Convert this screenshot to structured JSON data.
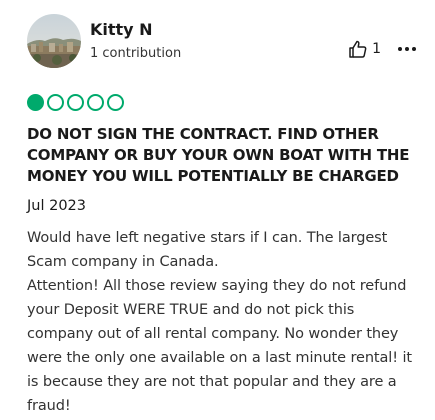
{
  "reviewer": {
    "name": "Kitty N",
    "contributions": "1 contribution"
  },
  "actions": {
    "helpful_count": "1",
    "thumb_icon": "thumbs-up-icon",
    "more_icon": "more-options-icon"
  },
  "rating": {
    "value": 1,
    "max": 5,
    "color": "#00aa6c"
  },
  "review": {
    "title": "DO NOT SIGN THE CONTRACT. FIND OTHER COMPANY OR BUY YOUR OWN BOAT WITH THE MONEY YOU WILL POTENTIALLY BE CHARGED",
    "date": "Jul 2023",
    "body": "Would have left negative stars if I can. The largest Scam company in Canada.\nAttention! All those review saying they do not refund your Deposit WERE TRUE and do not pick this company out of all rental company. No wonder they were the only one available on a last minute rental! it is because they are not that popular and they are a fraud!"
  }
}
